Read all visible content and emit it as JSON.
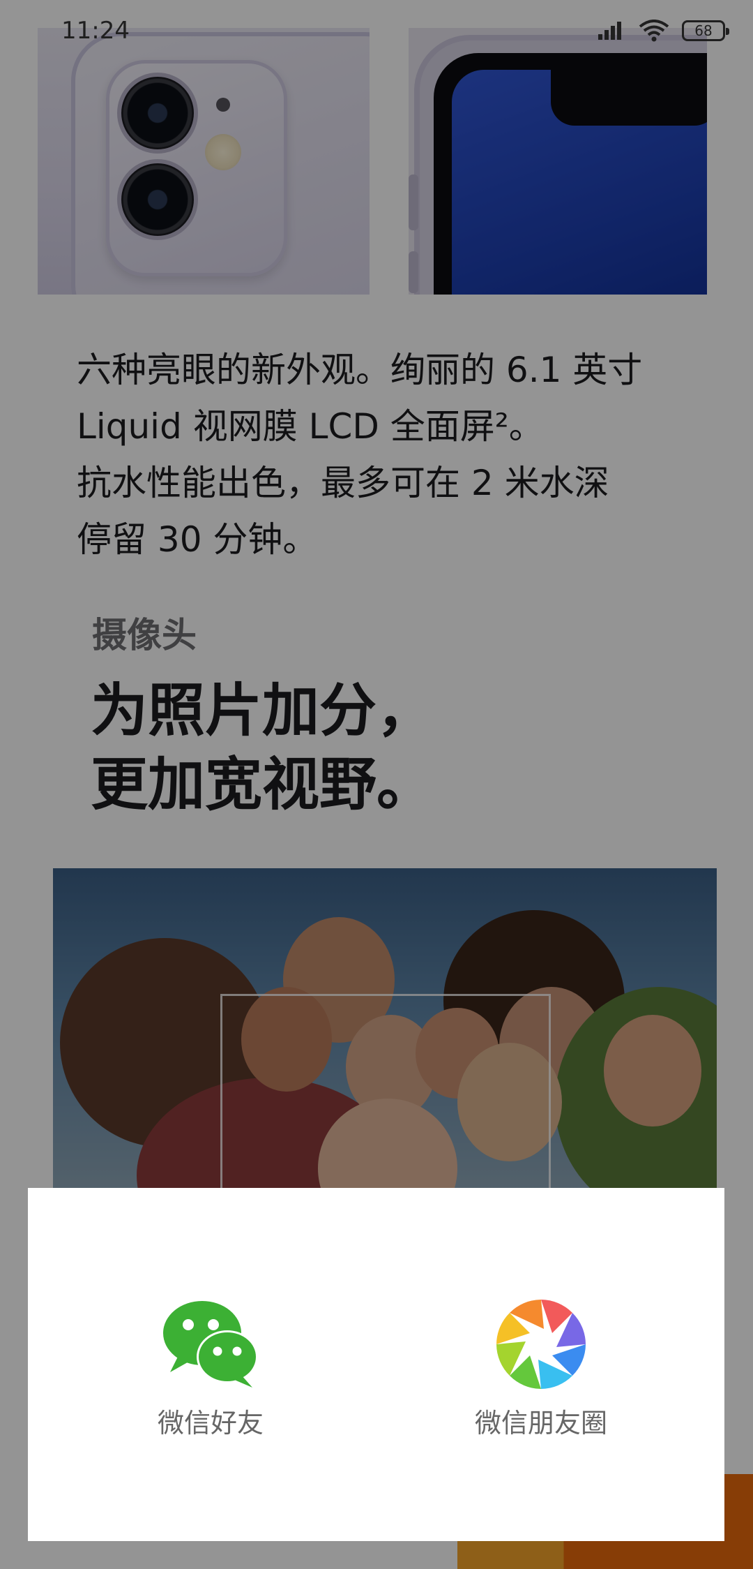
{
  "status_bar": {
    "time": "11:24",
    "battery": "68",
    "icons": [
      "signal-icon",
      "wifi-icon",
      "battery-icon"
    ]
  },
  "product": {
    "description_lines": [
      "六种亮眼的新外观。绚丽的 6.1 英寸",
      "Liquid 视网膜 LCD 全面屏²。",
      "抗水性能出色，最多可在 2 米水深",
      "停留 30 分钟。"
    ],
    "camera_section": {
      "label": "摄像头",
      "headline_lines": [
        "为照片加分，",
        "更加宽视野。"
      ]
    }
  },
  "share_sheet": {
    "options": [
      {
        "label": "微信好友",
        "icon": "wechat-icon"
      },
      {
        "label": "微信朋友圈",
        "icon": "moments-icon"
      }
    ]
  },
  "colors": {
    "overlay": "rgba(0,0,0,0.42)",
    "wechat_green": "#3cb034",
    "cta_orange": "#e96a0c",
    "cta_yellow": "#f5a42a"
  }
}
